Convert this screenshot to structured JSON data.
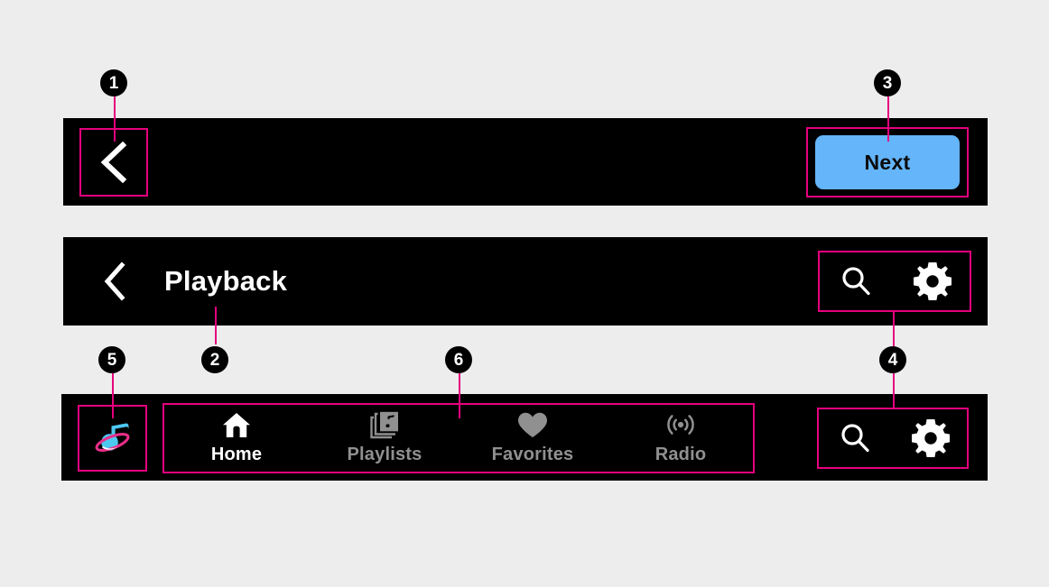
{
  "page": {
    "background_color": "#ededed",
    "annotation_color": "#e6007e",
    "bar_color": "#000000"
  },
  "top_bar": {
    "back_button": {
      "icon": "chevron-left-icon",
      "label": ""
    },
    "next_button": {
      "label": "Next",
      "background_color": "#64b5fa",
      "text_color": "#0b0b0b"
    }
  },
  "header_bar": {
    "back_button": {
      "icon": "chevron-left-icon"
    },
    "title": "Playback",
    "actions": [
      {
        "icon": "search-icon",
        "name": "search"
      },
      {
        "icon": "gear-icon",
        "name": "settings"
      }
    ]
  },
  "tab_bar": {
    "brand_logo": {
      "icon": "music-note-orbit-logo",
      "note_color": "#4dc8ef",
      "ring_color": "#ea2e8a"
    },
    "tabs": [
      {
        "label": "Home",
        "icon": "home-icon",
        "active": true
      },
      {
        "label": "Playlists",
        "icon": "playlist-library-icon",
        "active": false
      },
      {
        "label": "Favorites",
        "icon": "heart-icon",
        "active": false
      },
      {
        "label": "Radio",
        "icon": "radio-broadcast-icon",
        "active": false
      }
    ],
    "actions": [
      {
        "icon": "search-icon",
        "name": "search"
      },
      {
        "icon": "gear-icon",
        "name": "settings"
      }
    ],
    "active_color": "#ffffff",
    "inactive_color": "#909090"
  },
  "callouts": [
    {
      "number": "1",
      "target": "top-bar-back-button"
    },
    {
      "number": "2",
      "target": "header-title"
    },
    {
      "number": "3",
      "target": "next-button"
    },
    {
      "number": "4",
      "target": "action-icons"
    },
    {
      "number": "5",
      "target": "brand-logo"
    },
    {
      "number": "6",
      "target": "tab-group"
    }
  ]
}
